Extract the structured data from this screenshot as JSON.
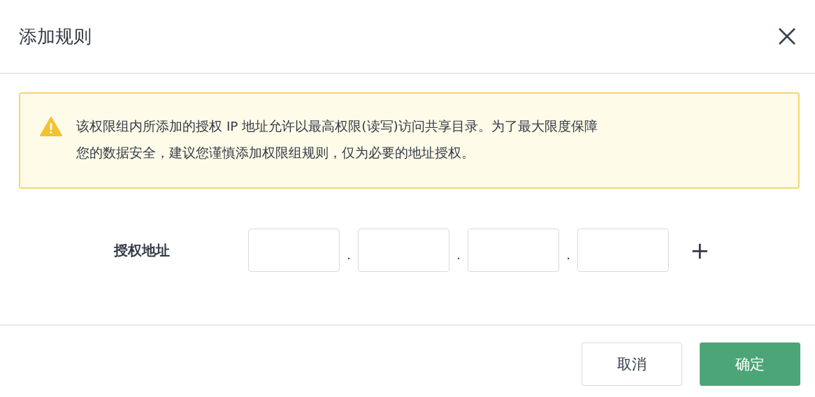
{
  "dialog": {
    "title": "添加规则"
  },
  "alert": {
    "text": "该权限组内所添加的授权 IP 地址允许以最高权限(读写)访问共享目录。为了最大限度保障您的数据安全，建议您谨慎添加权限组规则，仅为必要的地址授权。"
  },
  "form": {
    "label": "授权地址",
    "separators": [
      ".",
      ".",
      "."
    ],
    "add": "+"
  },
  "buttons": [
    {
      "label": "取消",
      "kind": "secondary"
    },
    {
      "label": "确定",
      "kind": "primary"
    }
  ]
}
